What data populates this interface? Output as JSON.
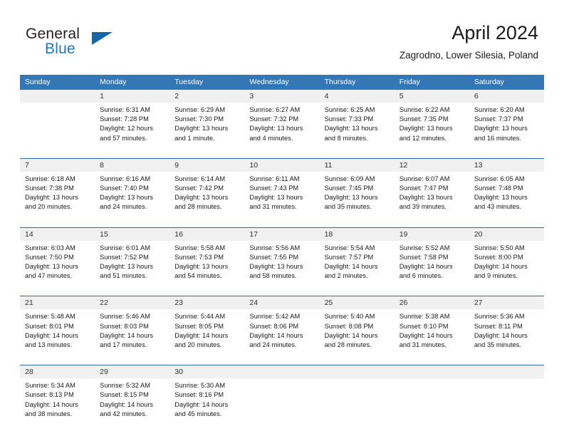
{
  "logo": {
    "text_primary": "General",
    "text_secondary": "Blue",
    "accent_color": "#1667a8"
  },
  "header": {
    "title": "April 2024",
    "subtitle": "Zagrodno, Lower Silesia, Poland"
  },
  "calendar": {
    "header_color": "#3577b5",
    "datenum_bg": "#f0f0f0",
    "weekday_headers": [
      "Sunday",
      "Monday",
      "Tuesday",
      "Wednesday",
      "Thursday",
      "Friday",
      "Saturday"
    ],
    "weeks": [
      [
        {
          "day": "",
          "sunrise": "",
          "sunset": "",
          "daylight1": "",
          "daylight2": ""
        },
        {
          "day": "1",
          "sunrise": "Sunrise: 6:31 AM",
          "sunset": "Sunset: 7:28 PM",
          "daylight1": "Daylight: 12 hours",
          "daylight2": "and 57 minutes."
        },
        {
          "day": "2",
          "sunrise": "Sunrise: 6:29 AM",
          "sunset": "Sunset: 7:30 PM",
          "daylight1": "Daylight: 13 hours",
          "daylight2": "and 1 minute."
        },
        {
          "day": "3",
          "sunrise": "Sunrise: 6:27 AM",
          "sunset": "Sunset: 7:32 PM",
          "daylight1": "Daylight: 13 hours",
          "daylight2": "and 4 minutes."
        },
        {
          "day": "4",
          "sunrise": "Sunrise: 6:25 AM",
          "sunset": "Sunset: 7:33 PM",
          "daylight1": "Daylight: 13 hours",
          "daylight2": "and 8 minutes."
        },
        {
          "day": "5",
          "sunrise": "Sunrise: 6:22 AM",
          "sunset": "Sunset: 7:35 PM",
          "daylight1": "Daylight: 13 hours",
          "daylight2": "and 12 minutes."
        },
        {
          "day": "6",
          "sunrise": "Sunrise: 6:20 AM",
          "sunset": "Sunset: 7:37 PM",
          "daylight1": "Daylight: 13 hours",
          "daylight2": "and 16 minutes."
        }
      ],
      [
        {
          "day": "7",
          "sunrise": "Sunrise: 6:18 AM",
          "sunset": "Sunset: 7:38 PM",
          "daylight1": "Daylight: 13 hours",
          "daylight2": "and 20 minutes."
        },
        {
          "day": "8",
          "sunrise": "Sunrise: 6:16 AM",
          "sunset": "Sunset: 7:40 PM",
          "daylight1": "Daylight: 13 hours",
          "daylight2": "and 24 minutes."
        },
        {
          "day": "9",
          "sunrise": "Sunrise: 6:14 AM",
          "sunset": "Sunset: 7:42 PM",
          "daylight1": "Daylight: 13 hours",
          "daylight2": "and 28 minutes."
        },
        {
          "day": "10",
          "sunrise": "Sunrise: 6:11 AM",
          "sunset": "Sunset: 7:43 PM",
          "daylight1": "Daylight: 13 hours",
          "daylight2": "and 31 minutes."
        },
        {
          "day": "11",
          "sunrise": "Sunrise: 6:09 AM",
          "sunset": "Sunset: 7:45 PM",
          "daylight1": "Daylight: 13 hours",
          "daylight2": "and 35 minutes."
        },
        {
          "day": "12",
          "sunrise": "Sunrise: 6:07 AM",
          "sunset": "Sunset: 7:47 PM",
          "daylight1": "Daylight: 13 hours",
          "daylight2": "and 39 minutes."
        },
        {
          "day": "13",
          "sunrise": "Sunrise: 6:05 AM",
          "sunset": "Sunset: 7:48 PM",
          "daylight1": "Daylight: 13 hours",
          "daylight2": "and 43 minutes."
        }
      ],
      [
        {
          "day": "14",
          "sunrise": "Sunrise: 6:03 AM",
          "sunset": "Sunset: 7:50 PM",
          "daylight1": "Daylight: 13 hours",
          "daylight2": "and 47 minutes."
        },
        {
          "day": "15",
          "sunrise": "Sunrise: 6:01 AM",
          "sunset": "Sunset: 7:52 PM",
          "daylight1": "Daylight: 13 hours",
          "daylight2": "and 51 minutes."
        },
        {
          "day": "16",
          "sunrise": "Sunrise: 5:58 AM",
          "sunset": "Sunset: 7:53 PM",
          "daylight1": "Daylight: 13 hours",
          "daylight2": "and 54 minutes."
        },
        {
          "day": "17",
          "sunrise": "Sunrise: 5:56 AM",
          "sunset": "Sunset: 7:55 PM",
          "daylight1": "Daylight: 13 hours",
          "daylight2": "and 58 minutes."
        },
        {
          "day": "18",
          "sunrise": "Sunrise: 5:54 AM",
          "sunset": "Sunset: 7:57 PM",
          "daylight1": "Daylight: 14 hours",
          "daylight2": "and 2 minutes."
        },
        {
          "day": "19",
          "sunrise": "Sunrise: 5:52 AM",
          "sunset": "Sunset: 7:58 PM",
          "daylight1": "Daylight: 14 hours",
          "daylight2": "and 6 minutes."
        },
        {
          "day": "20",
          "sunrise": "Sunrise: 5:50 AM",
          "sunset": "Sunset: 8:00 PM",
          "daylight1": "Daylight: 14 hours",
          "daylight2": "and 9 minutes."
        }
      ],
      [
        {
          "day": "21",
          "sunrise": "Sunrise: 5:48 AM",
          "sunset": "Sunset: 8:01 PM",
          "daylight1": "Daylight: 14 hours",
          "daylight2": "and 13 minutes."
        },
        {
          "day": "22",
          "sunrise": "Sunrise: 5:46 AM",
          "sunset": "Sunset: 8:03 PM",
          "daylight1": "Daylight: 14 hours",
          "daylight2": "and 17 minutes."
        },
        {
          "day": "23",
          "sunrise": "Sunrise: 5:44 AM",
          "sunset": "Sunset: 8:05 PM",
          "daylight1": "Daylight: 14 hours",
          "daylight2": "and 20 minutes."
        },
        {
          "day": "24",
          "sunrise": "Sunrise: 5:42 AM",
          "sunset": "Sunset: 8:06 PM",
          "daylight1": "Daylight: 14 hours",
          "daylight2": "and 24 minutes."
        },
        {
          "day": "25",
          "sunrise": "Sunrise: 5:40 AM",
          "sunset": "Sunset: 8:08 PM",
          "daylight1": "Daylight: 14 hours",
          "daylight2": "and 28 minutes."
        },
        {
          "day": "26",
          "sunrise": "Sunrise: 5:38 AM",
          "sunset": "Sunset: 8:10 PM",
          "daylight1": "Daylight: 14 hours",
          "daylight2": "and 31 minutes."
        },
        {
          "day": "27",
          "sunrise": "Sunrise: 5:36 AM",
          "sunset": "Sunset: 8:11 PM",
          "daylight1": "Daylight: 14 hours",
          "daylight2": "and 35 minutes."
        }
      ],
      [
        {
          "day": "28",
          "sunrise": "Sunrise: 5:34 AM",
          "sunset": "Sunset: 8:13 PM",
          "daylight1": "Daylight: 14 hours",
          "daylight2": "and 38 minutes."
        },
        {
          "day": "29",
          "sunrise": "Sunrise: 5:32 AM",
          "sunset": "Sunset: 8:15 PM",
          "daylight1": "Daylight: 14 hours",
          "daylight2": "and 42 minutes."
        },
        {
          "day": "30",
          "sunrise": "Sunrise: 5:30 AM",
          "sunset": "Sunset: 8:16 PM",
          "daylight1": "Daylight: 14 hours",
          "daylight2": "and 45 minutes."
        },
        {
          "day": "",
          "sunrise": "",
          "sunset": "",
          "daylight1": "",
          "daylight2": ""
        },
        {
          "day": "",
          "sunrise": "",
          "sunset": "",
          "daylight1": "",
          "daylight2": ""
        },
        {
          "day": "",
          "sunrise": "",
          "sunset": "",
          "daylight1": "",
          "daylight2": ""
        },
        {
          "day": "",
          "sunrise": "",
          "sunset": "",
          "daylight1": "",
          "daylight2": ""
        }
      ]
    ]
  }
}
